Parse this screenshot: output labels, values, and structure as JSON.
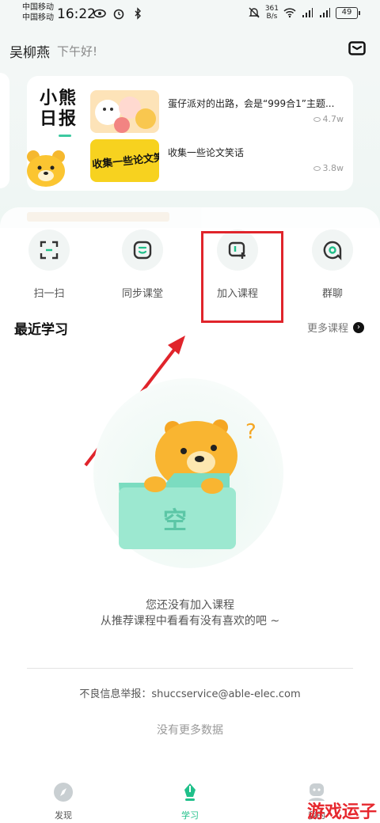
{
  "status_bar": {
    "carrier1": "中国移动",
    "carrier2": "中国移动",
    "time": "16:22",
    "net_speed_value": "361",
    "net_speed_unit": "B/s",
    "battery": "49"
  },
  "header": {
    "user_name": "吴柳燕",
    "greeting": "下午好!"
  },
  "banner": {
    "logo_text": "小熊日报",
    "items": [
      {
        "title": "蛋仔派对的出路，会是“999合1”主题...",
        "views": "4.7w"
      },
      {
        "title": "收集一些论文笑话",
        "views": "3.8w",
        "thumb_text": "收集一些论文笑话"
      }
    ]
  },
  "actions": [
    {
      "label": "扫一扫",
      "icon": "scan-icon"
    },
    {
      "label": "同步课堂",
      "icon": "classroom-icon"
    },
    {
      "label": "加入课程",
      "icon": "join-course-icon"
    },
    {
      "label": "群聊",
      "icon": "group-chat-icon"
    }
  ],
  "recent": {
    "title": "最近学习",
    "more": "更多课程",
    "empty_art_text": "空",
    "empty_line1": "您还没有加入课程",
    "empty_line2": "从推荐课程中看看有没有喜欢的吧 ~",
    "report": "不良信息举报：shuccservice@able-elec.com",
    "no_more": "没有更多数据"
  },
  "tabs": [
    {
      "label": "发现",
      "icon": "compass-icon",
      "active": false
    },
    {
      "label": "学习",
      "icon": "pen-icon",
      "active": true
    },
    {
      "label": "我的",
      "icon": "profile-icon",
      "active": false
    }
  ],
  "watermark": "游戏运子",
  "colors": {
    "accent": "#20c08a",
    "annotation": "#e0242b"
  }
}
